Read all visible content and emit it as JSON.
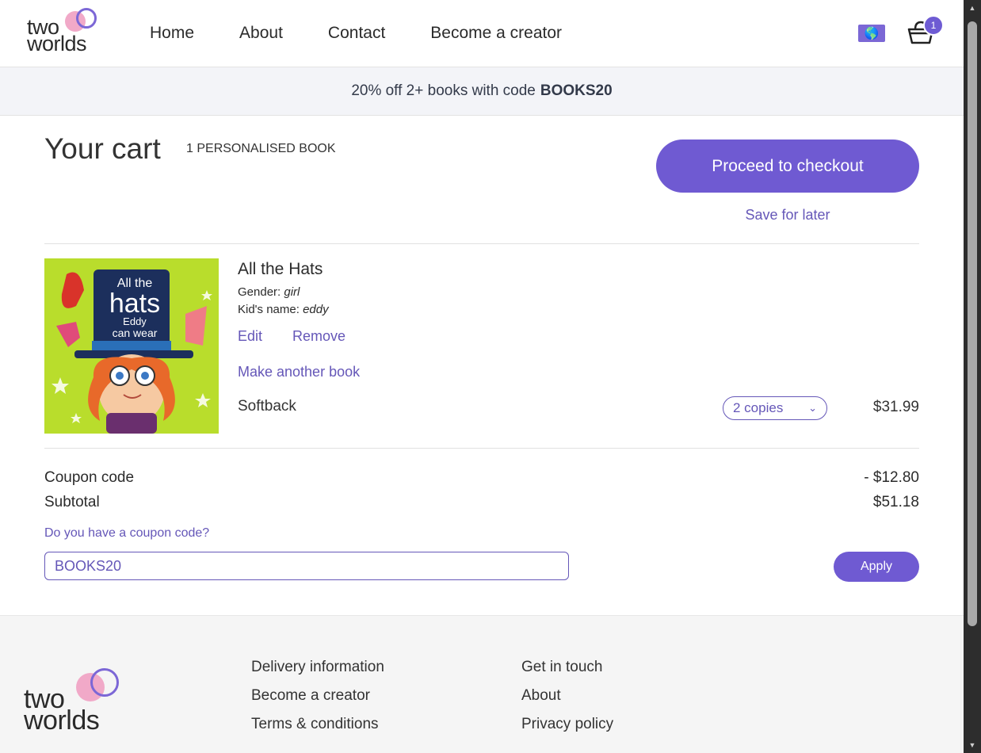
{
  "brand": {
    "logo_text_1": "two",
    "logo_text_2": "worlds"
  },
  "nav": [
    "Home",
    "About",
    "Contact",
    "Become a creator"
  ],
  "header": {
    "flag_icon": "globe-flag-icon",
    "cart_icon": "shopping-basket-icon",
    "cart_count": "1"
  },
  "promo": {
    "text": "20% off 2+ books with code",
    "code": "BOOKS20"
  },
  "cart": {
    "title": "Your cart",
    "count_label": "1 PERSONALISED BOOK",
    "checkout_label": "Proceed to checkout",
    "save_label": "Save for later"
  },
  "item": {
    "cover_line1": "All the",
    "cover_line2": "hats",
    "cover_line3": "Eddy",
    "cover_line4": "can wear",
    "title": "All the Hats",
    "gender_label": "Gender:",
    "gender_value": "girl",
    "name_label": "Kid's name:",
    "name_value": "eddy",
    "edit_label": "Edit",
    "remove_label": "Remove",
    "another_label": "Make another book",
    "format": "Softback",
    "copies": "2 copies",
    "price": "$31.99"
  },
  "summary": {
    "coupon_label": "Coupon code",
    "coupon_value": "- $12.80",
    "subtotal_label": "Subtotal",
    "subtotal_value": "$51.18",
    "coupon_question": "Do you have a coupon code?",
    "coupon_input_value": "BOOKS20",
    "apply_label": "Apply"
  },
  "footer": {
    "col1": [
      "Delivery information",
      "Become a creator",
      "Terms & conditions"
    ],
    "col2": [
      "Get in touch",
      "About",
      "Privacy policy"
    ]
  },
  "colors": {
    "accent": "#6f5ad2",
    "link": "#6557b8",
    "promo_bg": "#f3f4f8",
    "footer_bg": "#f5f5f5",
    "logo_pink": "#f1a9c8"
  }
}
